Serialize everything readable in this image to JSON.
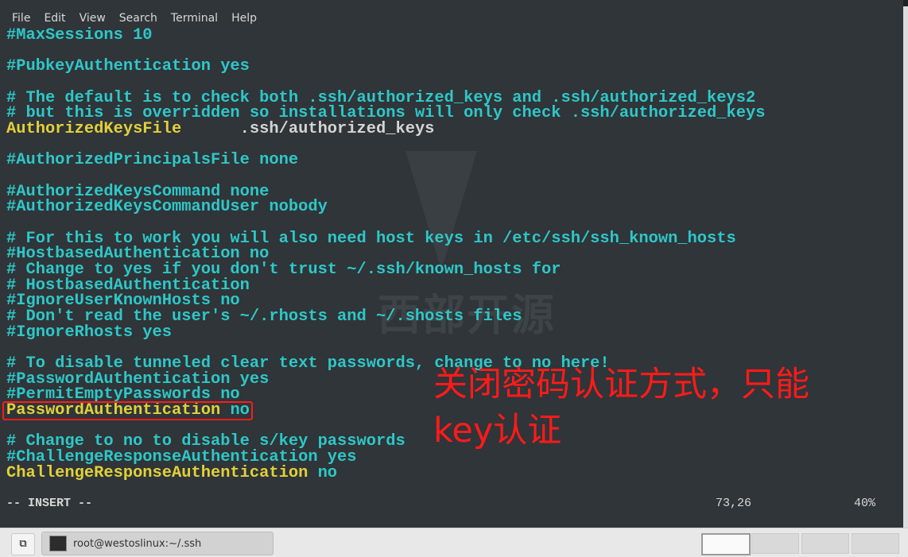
{
  "menu": [
    "File",
    "Edit",
    "View",
    "Search",
    "Terminal",
    "Help"
  ],
  "lines": [
    [
      [
        "c",
        "#MaxSessions 10"
      ]
    ],
    [],
    [
      [
        "c",
        "#PubkeyAuthentication yes"
      ]
    ],
    [],
    [
      [
        "c",
        "# The default is to check both .ssh/authorized_keys and .ssh/authorized_keys2"
      ]
    ],
    [
      [
        "c",
        "# but this is overridden so installations will only check .ssh/authorized_keys"
      ]
    ],
    [
      [
        "y",
        "AuthorizedKeysFile"
      ],
      [
        "w",
        "      .ssh/authorized_keys"
      ]
    ],
    [],
    [
      [
        "c",
        "#AuthorizedPrincipalsFile none"
      ]
    ],
    [],
    [
      [
        "c",
        "#AuthorizedKeysCommand none"
      ]
    ],
    [
      [
        "c",
        "#AuthorizedKeysCommandUser nobody"
      ]
    ],
    [],
    [
      [
        "c",
        "# For this to work you will also need host keys in /etc/ssh/ssh_known_hosts"
      ]
    ],
    [
      [
        "c",
        "#HostbasedAuthentication no"
      ]
    ],
    [
      [
        "c",
        "# Change to yes if you don't trust ~/.ssh/known_hosts for"
      ]
    ],
    [
      [
        "c",
        "# HostbasedAuthentication"
      ]
    ],
    [
      [
        "c",
        "#IgnoreUserKnownHosts no"
      ]
    ],
    [
      [
        "c",
        "# Don't read the user's ~/.rhosts and ~/.shosts files"
      ]
    ],
    [
      [
        "c",
        "#IgnoreRhosts yes"
      ]
    ],
    [],
    [
      [
        "c",
        "# To disable tunneled clear text passwords, change to no here!"
      ]
    ],
    [
      [
        "c",
        "#PasswordAuthentication yes"
      ]
    ],
    [
      [
        "c",
        "#PermitEmptyPasswords no"
      ]
    ],
    [
      [
        "y",
        "PasswordAuthentication"
      ],
      [
        "c",
        " no"
      ]
    ],
    [],
    [
      [
        "c",
        "# Change to no to disable s/key passwords"
      ]
    ],
    [
      [
        "c",
        "#ChallengeResponseAuthentication yes"
      ]
    ],
    [
      [
        "y",
        "ChallengeResponseAuthentication"
      ],
      [
        "c",
        " no"
      ]
    ]
  ],
  "status": {
    "mode": "-- INSERT --",
    "position": "73,26",
    "percent": "40%"
  },
  "annotation": {
    "line1": "关闭密码认证方式，只能",
    "line2": "key认证",
    "color": "#ff1a1a"
  },
  "watermark": "西部开源",
  "taskbar": {
    "task_label": "root@westoslinux:~/.ssh",
    "workspaces": 4,
    "active_workspace": 1
  },
  "colors": {
    "comment": "#2fc7c9",
    "keyword": "#e2d13a",
    "background": "#2f3538"
  }
}
